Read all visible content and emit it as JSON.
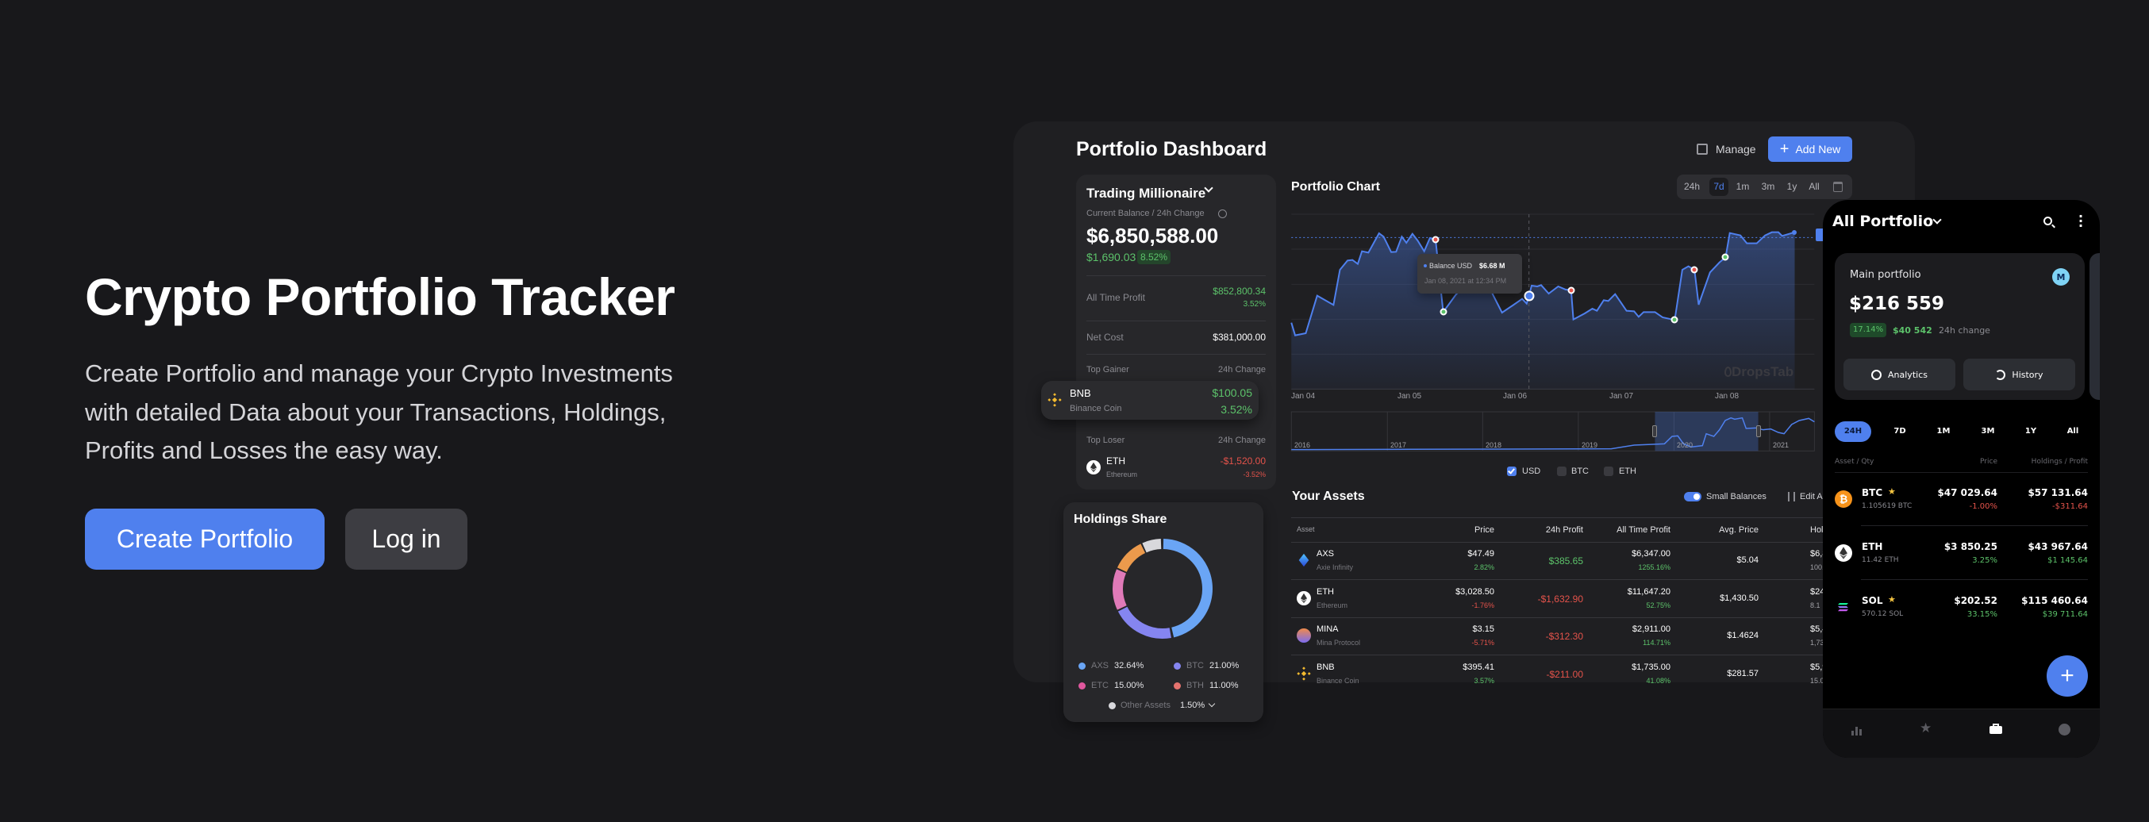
{
  "hero": {
    "title": "Crypto Portfolio Tracker",
    "description_lines": [
      "Create Portfolio and manage your Crypto Investments",
      "with detailed Data about your Transactions, Holdings,",
      "Profits and Losses the easy way."
    ],
    "create_button": "Create Portfolio",
    "login_button": "Log in"
  },
  "colors": {
    "accent": "#4f80ee",
    "positive": "#5cc26a",
    "negative": "#e5534b",
    "background": "#18181b"
  },
  "dashboard": {
    "title": "Portfolio Dashboard",
    "manage": "Manage",
    "add_new": "Add New",
    "portfolio": {
      "name": "Trading Millionaire",
      "balance_label": "Current Balance / 24h Change",
      "balance": "$6,850,588.00",
      "change": "$1,690.03",
      "change_pct": "8.52%",
      "all_time_label": "All Time Profit",
      "all_time_value": "$852,800.34",
      "all_time_pct": "3.52%",
      "net_cost_label": "Net Cost",
      "net_cost_value": "$381,000.00",
      "gainer_label": "Top Gainer",
      "change_col": "24h Change",
      "gainer": {
        "symbol": "BNB",
        "name": "Binance Coin",
        "value": "$100.05",
        "pct": "3.52%"
      },
      "loser_label": "Top Loser",
      "loser": {
        "symbol": "ETH",
        "name": "Ethereum",
        "value": "-$1,520.00",
        "pct": "-3.52%"
      }
    },
    "chart": {
      "title": "Portfolio Chart",
      "ranges": [
        "24h",
        "7d",
        "1m",
        "3m",
        "1y",
        "All"
      ],
      "active_range": "7d",
      "x_labels": [
        "Jan 04",
        "Jan 05",
        "Jan 06",
        "Jan 07",
        "Jan 08"
      ],
      "tooltip": {
        "label": "Balance USD",
        "value": "$6.68 M",
        "date": "Jan 08, 2021 at 12:34 PM"
      },
      "watermark": "DropsTab",
      "navigator_years": [
        "2016",
        "2017",
        "2018",
        "2019",
        "2020",
        "2021"
      ],
      "series_toggles": [
        {
          "label": "USD",
          "checked": true
        },
        {
          "label": "BTC",
          "checked": false
        },
        {
          "label": "ETH",
          "checked": false
        }
      ]
    },
    "holdings": {
      "title": "Holdings Share",
      "legend": [
        {
          "label": "AXS",
          "value": "32.64%",
          "color": "#6aa5f5"
        },
        {
          "label": "BTC",
          "value": "21.00%",
          "color": "#8585f0"
        },
        {
          "label": "ETC",
          "value": "15.00%",
          "color": "#e0579e"
        },
        {
          "label": "BTH",
          "value": "11.00%",
          "color": "#e5736e"
        }
      ],
      "other": {
        "label": "Other Assets",
        "value": "1.50%",
        "color": "#d8d8dc"
      }
    },
    "assets": {
      "title": "Your Assets",
      "small_balances": "Small Balances",
      "small_balances_on": true,
      "edit": "Edit A",
      "columns": [
        "Asset",
        "Price",
        "24h Profit",
        "All Time Profit",
        "Avg. Price",
        "Hol"
      ],
      "rows": [
        {
          "symbol": "AXS",
          "name": "Axie Infinity",
          "price": "$47.49",
          "price_pct": "2.82%",
          "profit_24h": "$385.65",
          "all_time": "$6,347.00",
          "all_time_pct": "1255.16%",
          "avg_price": "$5.04",
          "holdings": "$6,8",
          "holdings_sub": "100.",
          "icon": "axs-icon"
        },
        {
          "symbol": "ETH",
          "name": "Ethereum",
          "price": "$3,028.50",
          "price_pct": "-1.76%",
          "profit_24h": "-$1,632.90",
          "all_time": "$11,647.20",
          "all_time_pct": "52.75%",
          "avg_price": "$1,430.50",
          "holdings": "$24,6",
          "holdings_sub": "8.1",
          "icon": "eth-icon"
        },
        {
          "symbol": "MINA",
          "name": "Mina Protocol",
          "price": "$3.15",
          "price_pct": "-5.71%",
          "profit_24h": "-$312.30",
          "all_time": "$2,911.00",
          "all_time_pct": "114.71%",
          "avg_price": "$1.4624",
          "holdings": "$5,4",
          "holdings_sub": "1,735.0",
          "icon": "mina-icon"
        },
        {
          "symbol": "BNB",
          "name": "Binance Coin",
          "price": "$395.41",
          "price_pct": "3.57%",
          "profit_24h": "-$211.00",
          "all_time": "$1,735.00",
          "all_time_pct": "41.08%",
          "avg_price": "$281.57",
          "holdings": "$5,9",
          "holdings_sub": "15.0",
          "icon": "bnb-icon"
        }
      ]
    }
  },
  "mobile": {
    "title": "All Portfolio",
    "card": {
      "name": "Main portfolio",
      "avatar": "M",
      "value": "$216 559",
      "pct": "17.14%",
      "change": "$40 542",
      "change_label": "24h change",
      "analytics": "Analytics",
      "history": "History"
    },
    "tabs": [
      "24H",
      "7D",
      "1M",
      "3M",
      "1Y",
      "All"
    ],
    "active_tab": "24H",
    "headers": {
      "asset": "Asset / Qty",
      "price": "Price",
      "holdings": "Holdings / Profit"
    },
    "rows": [
      {
        "symbol": "BTC",
        "starred": true,
        "qty": "1.105619 BTC",
        "price": "$47 029.64",
        "pct": "-1.00%",
        "holdings": "$57 131.64",
        "profit": "-$311.64",
        "icon": "btc-icon"
      },
      {
        "symbol": "ETH",
        "starred": false,
        "qty": "11.42 ETH",
        "price": "$3 850.25",
        "pct": "3.25%",
        "holdings": "$43 967.64",
        "profit": "$1 145.64",
        "icon": "eth-icon"
      },
      {
        "symbol": "SOL",
        "starred": true,
        "qty": "570.12 SOL",
        "price": "$202.52",
        "pct": "33.15%",
        "holdings": "$115 460.64",
        "profit": "$39 711.64",
        "icon": "sol-icon"
      }
    ],
    "nav": [
      "chart-icon",
      "star-icon",
      "briefcase-icon",
      "profile-icon"
    ],
    "active_nav": "briefcase-icon"
  }
}
